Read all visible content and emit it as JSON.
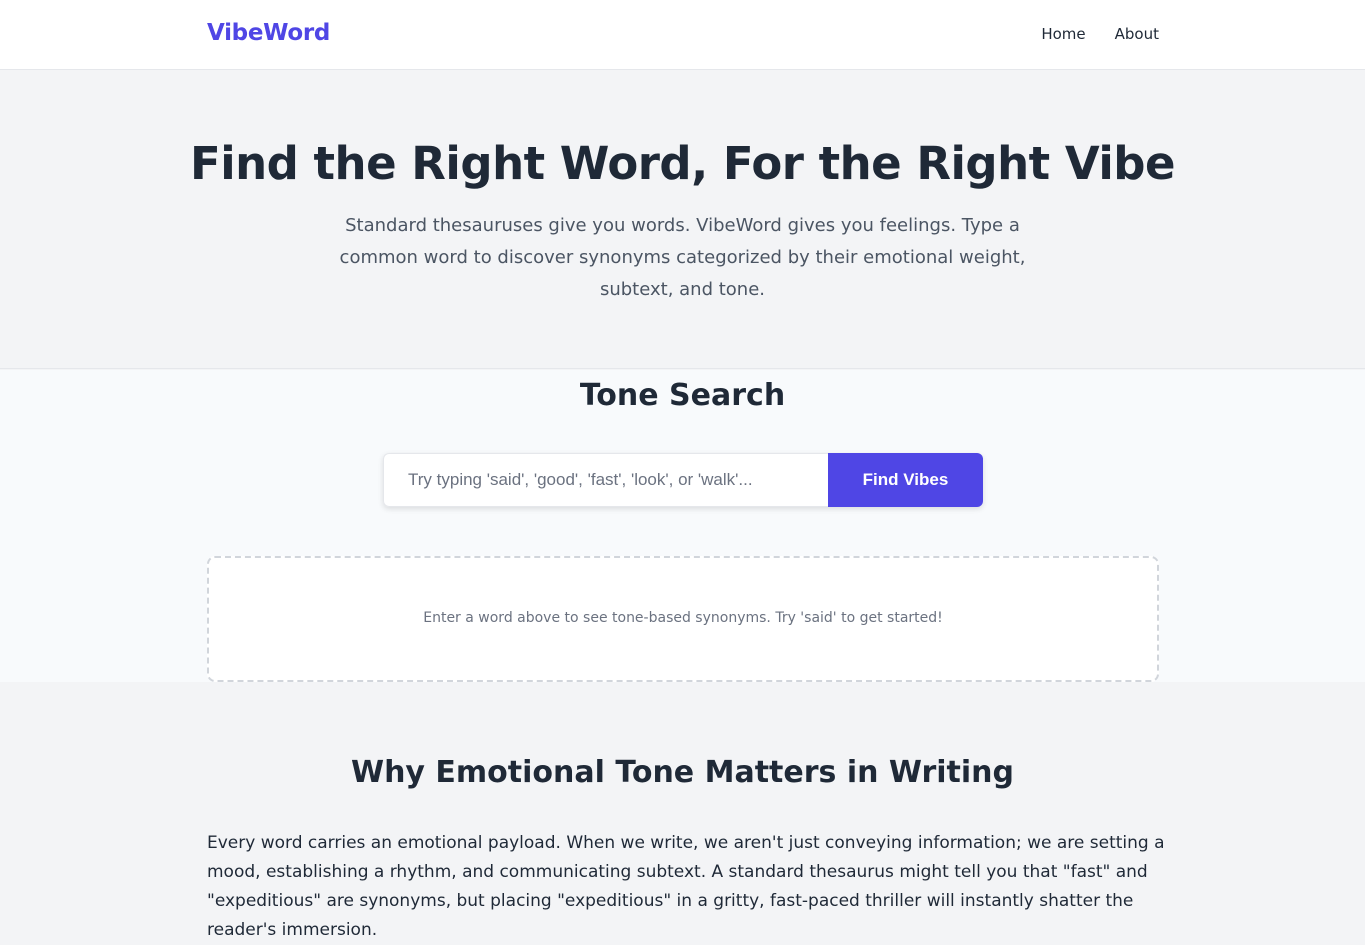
{
  "navbar": {
    "logo": "VibeWord",
    "links": [
      "Home",
      "About"
    ]
  },
  "hero": {
    "title": "Find the Right Word, For the Right Vibe",
    "subtitle": "Standard thesauruses give you words. VibeWord gives you feelings. Type a common word to discover synonyms categorized by their emotional weight, subtext, and tone."
  },
  "search": {
    "title": "Tone Search",
    "placeholder": "Try typing 'said', 'good', 'fast', 'look', or 'walk'...",
    "button_label": "Find Vibes",
    "empty_message": "Enter a word above to see tone-based synonyms. Try 'said' to get started!"
  },
  "why": {
    "title": "Why Emotional Tone Matters in Writing",
    "paragraph": "Every word carries an emotional payload. When we write, we aren't just conveying information; we are setting a mood, establishing a rhythm, and communicating subtext. A standard thesaurus might tell you that \"fast\" and \"expeditious\" are synonyms, but placing \"expeditious\" in a gritty, fast-paced thriller will instantly shatter the reader's immersion."
  },
  "colors": {
    "brand": "#4f46e5",
    "text": "#1f2937",
    "muted": "#6b7280",
    "background": "#f3f4f6"
  }
}
